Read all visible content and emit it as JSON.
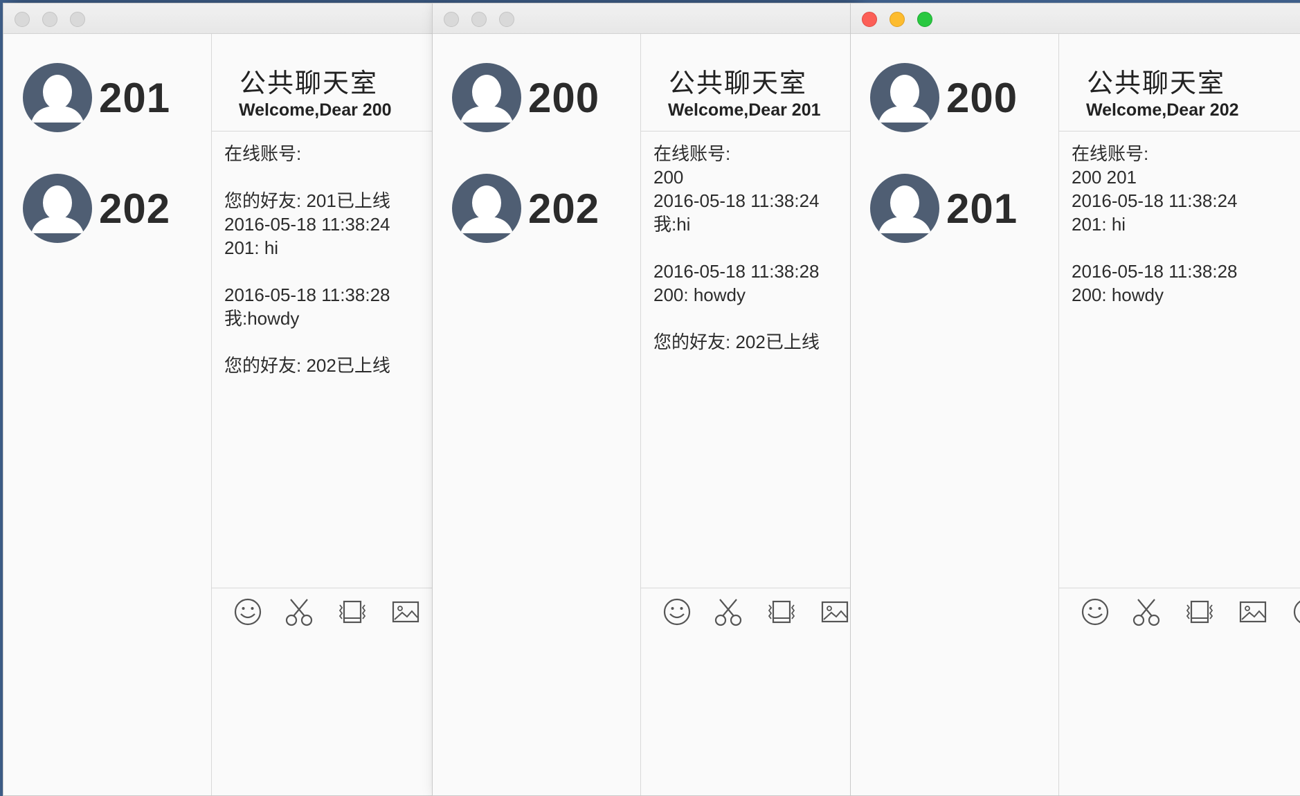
{
  "windows": [
    {
      "active": false,
      "friends": [
        "201",
        "202"
      ],
      "room_title": "公共聊天室",
      "welcome": "Welcome,Dear 200",
      "messages": [
        "在线账号:",
        "",
        "您的好友: 201已上线",
        "2016-05-18 11:38:24",
        "201: hi",
        "",
        "2016-05-18 11:38:28",
        "我:howdy",
        "",
        "您的好友: 202已上线"
      ]
    },
    {
      "active": false,
      "friends": [
        "200",
        "202"
      ],
      "room_title": "公共聊天室",
      "welcome": "Welcome,Dear 201",
      "messages": [
        "在线账号:",
        "200",
        "2016-05-18 11:38:24",
        "我:hi",
        "",
        "2016-05-18 11:38:28",
        "200: howdy",
        "",
        "您的好友: 202已上线"
      ]
    },
    {
      "active": true,
      "friends": [
        "200",
        "201"
      ],
      "room_title": "公共聊天室",
      "welcome": "Welcome,Dear 202",
      "messages": [
        "在线账号:",
        "200 201",
        "2016-05-18 11:38:24",
        "201: hi",
        "",
        "2016-05-18 11:38:28",
        "200: howdy"
      ]
    }
  ],
  "toolbar_icons": [
    "smiley-icon",
    "scissors-icon",
    "screen-capture-icon",
    "image-icon",
    "extra-icon"
  ],
  "colors": {
    "avatar": "#4f5e73",
    "close": "#fc5f57",
    "minimize": "#fdbc2e",
    "zoom": "#29c840",
    "desktop": "#3f5f8a"
  }
}
